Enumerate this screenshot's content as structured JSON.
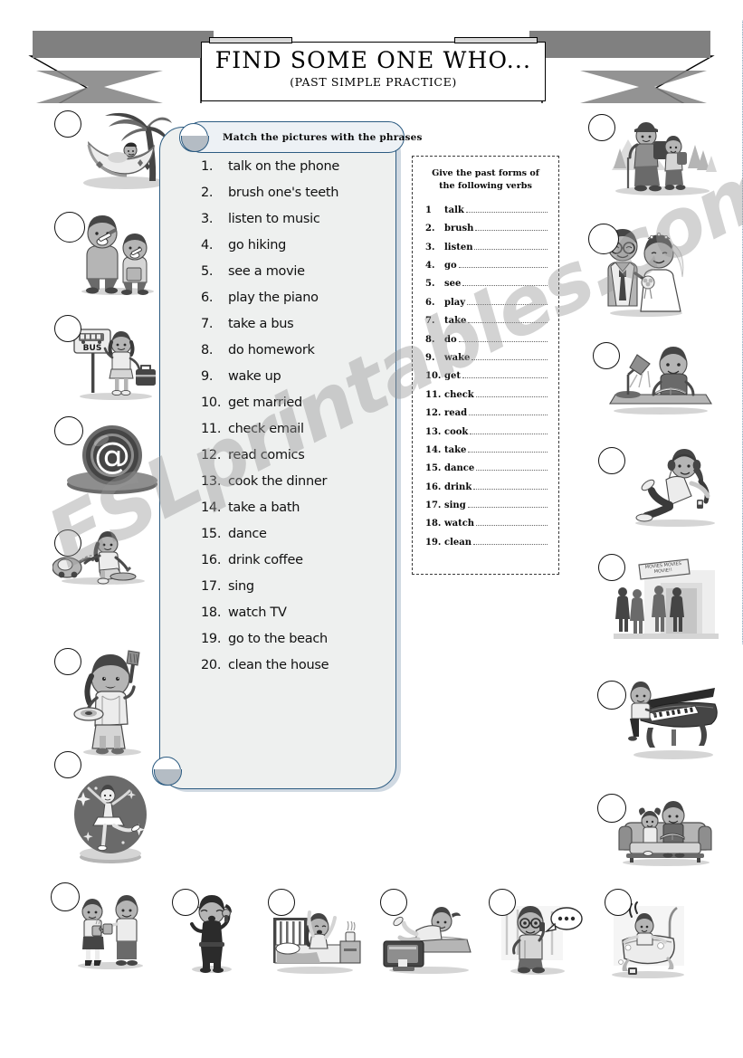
{
  "worksheet": {
    "title": "FIND SOME ONE WHO...",
    "subtitle": "(PAST SIMPLE PRACTICE)",
    "watermark": "ESLprintables.com"
  },
  "instruction": {
    "text": "Match the pictures with the phrases"
  },
  "phrases": [
    {
      "num": "1.",
      "text": "talk on the phone"
    },
    {
      "num": "2.",
      "text": "brush one's teeth"
    },
    {
      "num": "3.",
      "text": "listen to music"
    },
    {
      "num": "4.",
      "text": "go hiking"
    },
    {
      "num": "5.",
      "text": "see a movie"
    },
    {
      "num": "6.",
      "text": "play the piano"
    },
    {
      "num": "7.",
      "text": "take a bus"
    },
    {
      "num": "8.",
      "text": "do homework"
    },
    {
      "num": "9.",
      "text": "wake up"
    },
    {
      "num": "10.",
      "text": "get married"
    },
    {
      "num": "11.",
      "text": "check email"
    },
    {
      "num": "12.",
      "text": "read comics"
    },
    {
      "num": "13.",
      "text": "cook the dinner"
    },
    {
      "num": "14.",
      "text": "take a bath"
    },
    {
      "num": "15.",
      "text": "dance"
    },
    {
      "num": "16.",
      "text": "drink coffee"
    },
    {
      "num": "17.",
      "text": "sing"
    },
    {
      "num": "18.",
      "text": "watch TV"
    },
    {
      "num": "19.",
      "text": "go to the beach"
    },
    {
      "num": "20.",
      "text": "clean the house"
    }
  ],
  "verb_exercise": {
    "title": "Give the past forms of the following verbs",
    "verbs": [
      {
        "num": "1",
        "word": "talk"
      },
      {
        "num": "2.",
        "word": "brush"
      },
      {
        "num": "3.",
        "word": "listen"
      },
      {
        "num": "4.",
        "word": "go"
      },
      {
        "num": "5.",
        "word": "see"
      },
      {
        "num": "6.",
        "word": "play"
      },
      {
        "num": "7.",
        "word": "take"
      },
      {
        "num": "8.",
        "word": "do"
      },
      {
        "num": "9.",
        "word": "wake"
      },
      {
        "num": "10.",
        "word": "get"
      },
      {
        "num": "11.",
        "word": "check"
      },
      {
        "num": "12.",
        "word": "read"
      },
      {
        "num": "13.",
        "word": "cook"
      },
      {
        "num": "14.",
        "word": "take"
      },
      {
        "num": "15.",
        "word": "dance"
      },
      {
        "num": "16.",
        "word": "drink"
      },
      {
        "num": "17.",
        "word": "sing"
      },
      {
        "num": "18.",
        "word": "watch"
      },
      {
        "num": "19.",
        "word": "clean"
      }
    ]
  },
  "pictures": {
    "left_column": [
      {
        "name": "hammock-beach-picture",
        "label": "go to the beach"
      },
      {
        "name": "brushing-teeth-picture",
        "label": "brush one's teeth"
      },
      {
        "name": "bus-stop-picture",
        "label": "take a bus",
        "sign_text": "BUS"
      },
      {
        "name": "email-at-symbol-picture",
        "label": "check email",
        "symbol": "@"
      },
      {
        "name": "vacuum-cleaning-picture",
        "label": "clean the house"
      },
      {
        "name": "cooking-dinner-picture",
        "label": "cook the dinner"
      },
      {
        "name": "ballet-dancing-picture",
        "label": "dance"
      }
    ],
    "right_column": [
      {
        "name": "hiking-picture",
        "label": "go hiking"
      },
      {
        "name": "wedding-couple-picture",
        "label": "get married"
      },
      {
        "name": "homework-desk-picture",
        "label": "do homework"
      },
      {
        "name": "listening-music-picture",
        "label": "listen to music"
      },
      {
        "name": "movie-theatre-picture",
        "label": "see a movie"
      },
      {
        "name": "piano-playing-picture",
        "label": "play the piano"
      },
      {
        "name": "reading-comics-picture",
        "label": "read comics"
      }
    ],
    "bottom_row": [
      {
        "name": "drinking-coffee-picture",
        "label": "drink coffee"
      },
      {
        "name": "singing-picture",
        "label": "sing"
      },
      {
        "name": "waking-up-picture",
        "label": "wake up"
      },
      {
        "name": "watching-tv-picture",
        "label": "watch TV"
      },
      {
        "name": "talking-phone-picture",
        "label": "talk on the phone"
      },
      {
        "name": "taking-bath-picture",
        "label": "take a bath"
      }
    ]
  },
  "colors": {
    "panel_border": "#2d5c82",
    "panel_fill": "#eef0ef",
    "ribbon_gray": "#808080",
    "ink": "#111111"
  }
}
